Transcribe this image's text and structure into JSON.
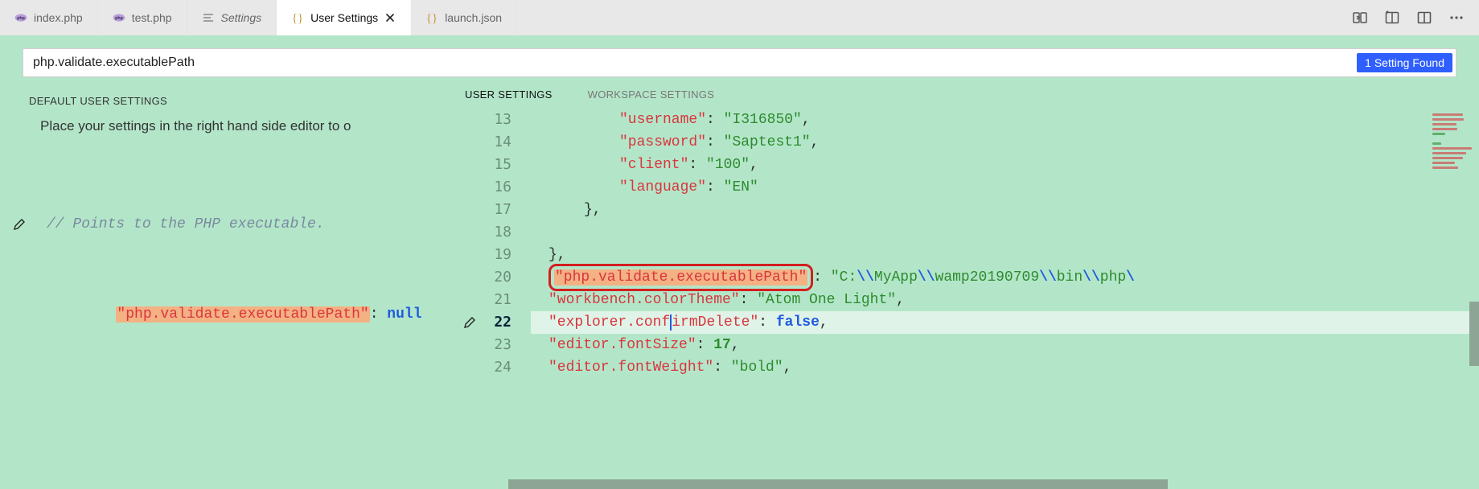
{
  "tabs": [
    {
      "label": "index.php",
      "icon": "php"
    },
    {
      "label": "test.php",
      "icon": "php"
    },
    {
      "label": "Settings",
      "icon": "lines",
      "italic": true
    },
    {
      "label": "User Settings",
      "icon": "braces",
      "active": true,
      "close": true
    },
    {
      "label": "launch.json",
      "icon": "braces"
    }
  ],
  "title_actions": [
    "open-changes",
    "split-editor",
    "layout",
    "more"
  ],
  "search": {
    "value": "php.validate.executablePath",
    "found_label": "1 Setting Found"
  },
  "left": {
    "heading": "DEFAULT USER SETTINGS",
    "desc": "Place your settings in the right hand side editor to o",
    "comment": "// Points to the PHP executable.",
    "key": "\"php.validate.executablePath\"",
    "val": "null"
  },
  "right": {
    "heading_user": "USER SETTINGS",
    "heading_ws": "WORKSPACE SETTINGS",
    "lines": [
      {
        "n": 13,
        "k": "\"username\"",
        "v": "\"I316850\"",
        "type": "str",
        "comma": true,
        "indent": 3
      },
      {
        "n": 14,
        "k": "\"password\"",
        "v": "\"Saptest1\"",
        "type": "str",
        "comma": true,
        "indent": 3
      },
      {
        "n": 15,
        "k": "\"client\"",
        "v": "\"100\"",
        "type": "str",
        "comma": true,
        "indent": 3
      },
      {
        "n": 16,
        "k": "\"language\"",
        "v": "\"EN\"",
        "type": "str",
        "comma": false,
        "indent": 3
      },
      {
        "n": 17,
        "raw": "},",
        "indent": 2
      },
      {
        "n": 18,
        "raw": "",
        "indent": 2
      },
      {
        "n": 19,
        "raw": "},",
        "indent": 1
      },
      {
        "n": 20,
        "k": "\"php.validate.executablePath\"",
        "v_path": {
          "pre": "\"C:",
          "segs": [
            "MyApp",
            "wamp20190709",
            "bin",
            "php"
          ]
        },
        "type": "path",
        "comma": false,
        "indent": 1,
        "boxed": true
      },
      {
        "n": 21,
        "k": "\"workbench.colorTheme\"",
        "v": "\"Atom One Light\"",
        "type": "str",
        "comma": true,
        "indent": 1
      },
      {
        "n": 22,
        "k": "\"explorer.confirmDelete\"",
        "v": "false",
        "type": "kw",
        "comma": true,
        "indent": 1,
        "current": true,
        "split_key": [
          "\"explorer.conf",
          "irmDelete\""
        ]
      },
      {
        "n": 23,
        "k": "\"editor.fontSize\"",
        "v": "17",
        "type": "num",
        "comma": true,
        "indent": 1
      },
      {
        "n": 24,
        "k": "\"editor.fontWeight\"",
        "v": "\"bold\"",
        "type": "str",
        "comma": true,
        "indent": 1
      }
    ]
  }
}
